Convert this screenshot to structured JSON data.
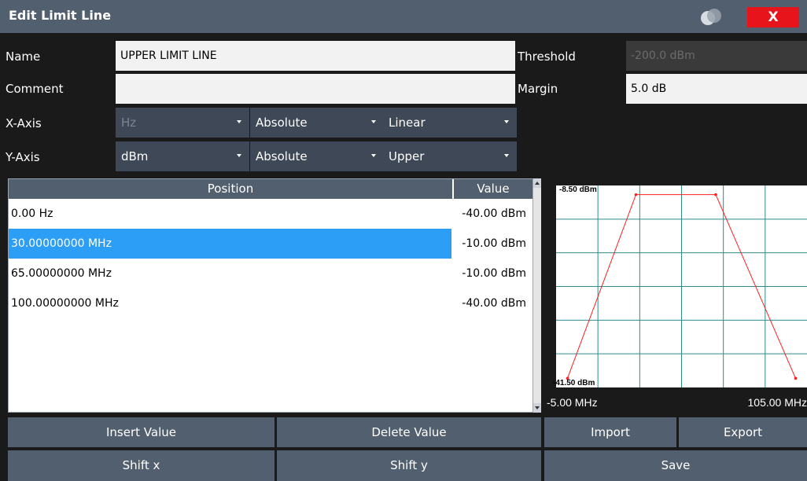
{
  "window": {
    "title": "Edit Limit Line",
    "close_label": "X"
  },
  "form": {
    "name_label": "Name",
    "name_value": "UPPER LIMIT LINE",
    "comment_label": "Comment",
    "comment_value": "",
    "threshold_label": "Threshold",
    "threshold_value": "-200.0 dBm",
    "margin_label": "Margin",
    "margin_value": "5.0 dB",
    "xaxis_label": "X-Axis",
    "xaxis_unit": "Hz",
    "xaxis_mode": "Absolute",
    "xaxis_scale": "Linear",
    "yaxis_label": "Y-Axis",
    "yaxis_unit": "dBm",
    "yaxis_mode": "Absolute",
    "yaxis_type": "Upper"
  },
  "table": {
    "col_position": "Position",
    "col_value": "Value",
    "rows": [
      {
        "position": "0.00 Hz",
        "value": "-40.00 dBm"
      },
      {
        "position": "30.00000000 MHz",
        "value": "-10.00 dBm"
      },
      {
        "position": "65.00000000 MHz",
        "value": "-10.00 dBm"
      },
      {
        "position": "100.00000000 MHz",
        "value": "-40.00 dBm"
      }
    ],
    "selected_row": 1
  },
  "chart_labels": {
    "y_top": "-8.50 dBm",
    "y_bottom": "-41.50 dBm",
    "x_start": "-5.00 MHz",
    "x_end": "105.00 MHz"
  },
  "chart_data": {
    "type": "line",
    "x_unit": "MHz",
    "y_unit": "dBm",
    "xlim": [
      -5,
      105
    ],
    "ylim": [
      -41.5,
      -8.5
    ],
    "grid": true,
    "series": [
      {
        "x": [
          0,
          30,
          65,
          100
        ],
        "y": [
          -40,
          -10,
          -10,
          -40
        ],
        "color": "#ff2020"
      }
    ]
  },
  "buttons": {
    "insert_value": "Insert Value",
    "delete_value": "Delete Value",
    "import": "Import",
    "export": "Export",
    "shift_x": "Shift x",
    "shift_y": "Shift y",
    "save": "Save"
  },
  "colors": {
    "accent_select": "#2c9ef5",
    "limit_line": "#ff2020",
    "button_bg": "#525f6f",
    "close_bg": "#e8141c"
  }
}
